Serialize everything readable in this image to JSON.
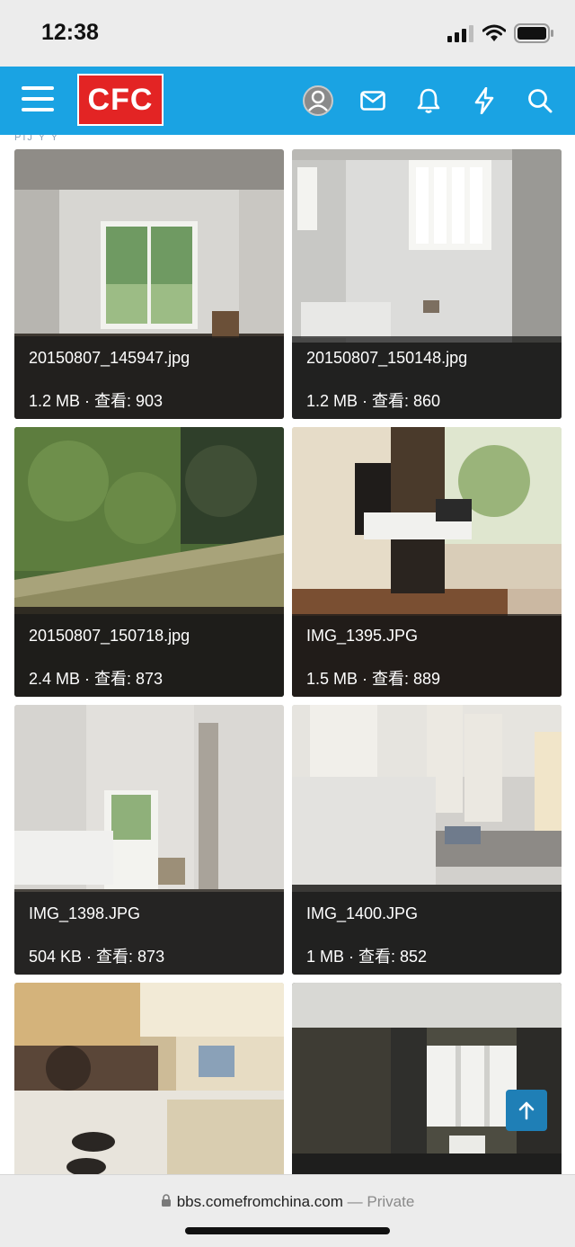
{
  "status_bar": {
    "time": "12:38"
  },
  "header": {
    "logo_text": "CFC",
    "accent": "#1aa3e3",
    "logo_color": "#e32424"
  },
  "subline": "PIJ Y Y",
  "attachments": [
    {
      "name": "20150807_145947.jpg",
      "meta": "1.2 MB · 查看: 903"
    },
    {
      "name": "20150807_150148.jpg",
      "meta": "1.2 MB · 查看: 860"
    },
    {
      "name": "20150807_150718.jpg",
      "meta": "2.4 MB · 查看: 873"
    },
    {
      "name": "IMG_1395.JPG",
      "meta": "1.5 MB · 查看: 889"
    },
    {
      "name": "IMG_1398.JPG",
      "meta": "504 KB · 查看: 873"
    },
    {
      "name": "IMG_1400.JPG",
      "meta": "1 MB · 查看: 852"
    }
  ],
  "browser": {
    "url": "bbs.comefromchina.com",
    "privacy": "— Private"
  }
}
